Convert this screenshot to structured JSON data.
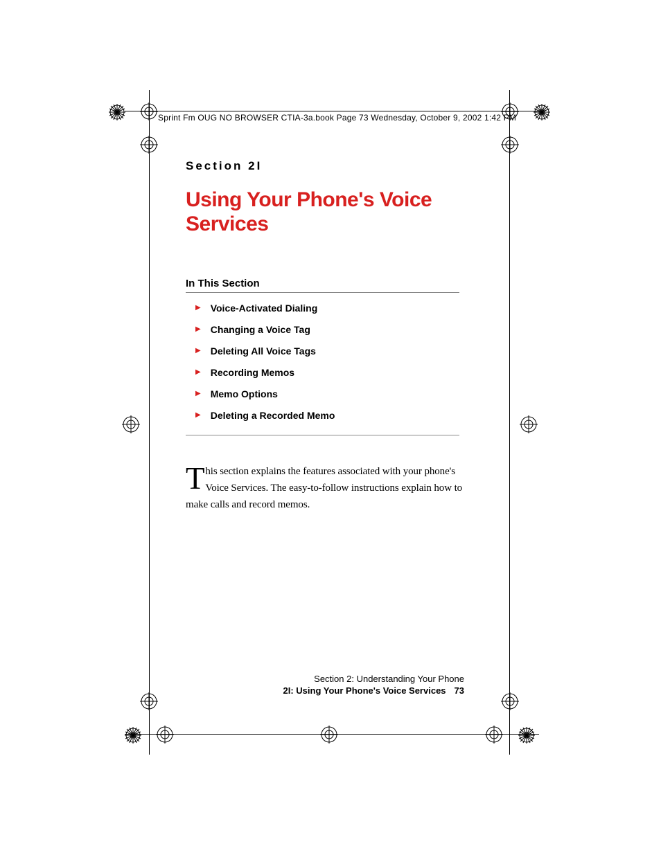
{
  "header_strip": {
    "text": "Sprint Fm OUG NO BROWSER CTIA-3a.book  Page 73  Wednesday, October 9, 2002  1:42 PM"
  },
  "section_label": "Section 2I",
  "title": "Using Your Phone's Voice Services",
  "subhead": "In This Section",
  "toc": [
    "Voice-Activated Dialing",
    "Changing a Voice Tag",
    "Deleting All Voice Tags",
    "Recording Memos",
    "Memo Options",
    "Deleting a Recorded Memo"
  ],
  "paragraph": {
    "dropcap": "T",
    "rest": "his section explains the features associated with your phone's Voice Services. The easy-to-follow instructions explain how to make calls and record memos."
  },
  "footer": {
    "line1": "Section 2: Understanding Your Phone",
    "line2": "2I: Using Your Phone's Voice Services",
    "page": "73"
  }
}
